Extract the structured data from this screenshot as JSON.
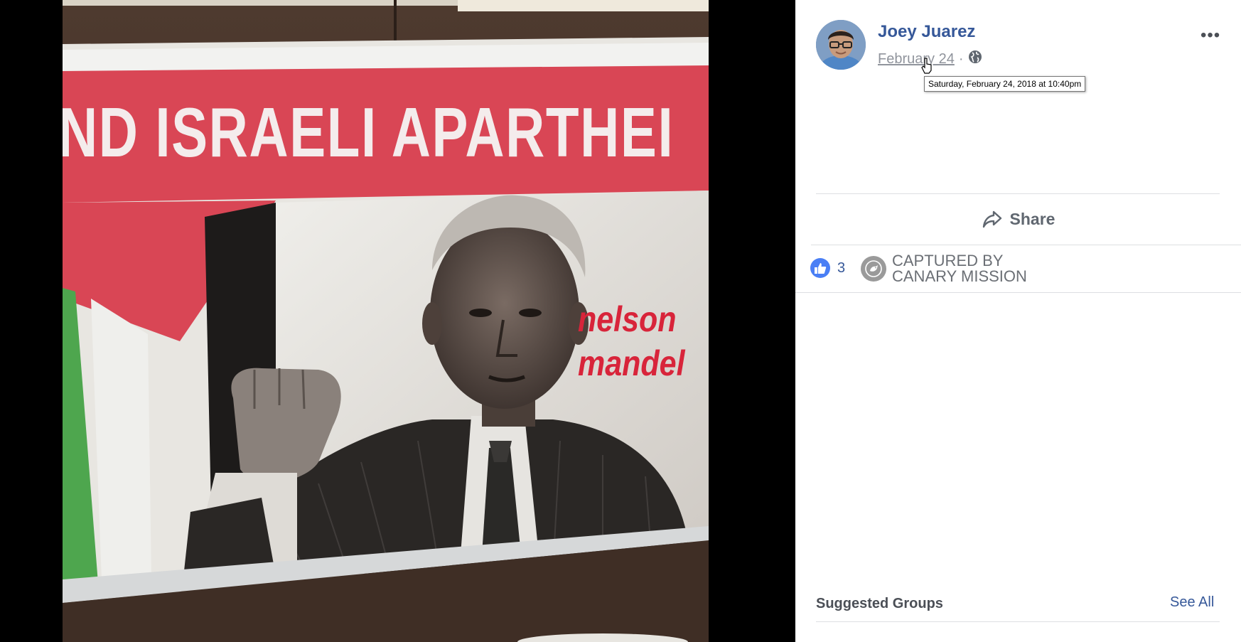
{
  "photo": {
    "poster_headline": "ND ISRAELI APARTHEI",
    "poster_name_line1": "nelson",
    "poster_name_line2": "mandel"
  },
  "post": {
    "author_name": "Joey Juarez",
    "date": "February 24",
    "separator": "·",
    "privacy_icon": "globe-icon",
    "more_label": "•••",
    "tooltip": "Saturday, February 24, 2018 at 10:40pm"
  },
  "actions": {
    "share_label": "Share",
    "share_icon": "share-arrow-icon"
  },
  "reactions": {
    "like_icon": "thumbs-up-icon",
    "like_count": "3",
    "captured_line1": "CAPTURED BY",
    "captured_line2": "CANARY MISSION"
  },
  "sidebar": {
    "suggested_title": "Suggested Groups",
    "see_all_label": "See All"
  },
  "colors": {
    "link_blue": "#365899",
    "like_blue": "#4a7ff5",
    "poster_red": "#d8243a",
    "meta_gray": "#90949c"
  }
}
